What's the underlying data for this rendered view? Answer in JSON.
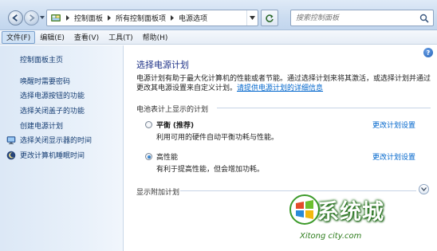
{
  "address_bar": {
    "breadcrumbs": [
      "控制面板",
      "所有控制面板项",
      "电源选项"
    ],
    "search_placeholder": "搜索控制面板"
  },
  "menu": {
    "items": [
      "文件(F)",
      "编辑(E)",
      "查看(V)",
      "工具(T)",
      "帮助(H)"
    ],
    "active_index": 0
  },
  "left_pane": {
    "home_link": "控制面板主页",
    "links": [
      "唤醒时需要密码",
      "选择电源按钮的功能",
      "选择关闭盖子的功能",
      "创建电源计划",
      "选择关闭显示器的时间",
      "更改计算机睡眠时间"
    ]
  },
  "main": {
    "help_glyph": "?",
    "title": "选择电源计划",
    "description": "电源计划有助于最大化计算机的性能或者节能。通过选择计划来将其激活，或选择计划并通过更改其电源设置来自定义计划。",
    "description_link": "请提供电源计划的详细信息",
    "section_label": "电池表计上显示的计划",
    "plans": [
      {
        "name": "平衡",
        "tag": "(推荐)",
        "description": "利用可用的硬件自动平衡功耗与性能。",
        "link": "更改计划设置",
        "selected": false
      },
      {
        "name": "高性能",
        "tag": "",
        "description": "有利于提高性能，但会增加功耗。",
        "link": "更改计划设置",
        "selected": true
      }
    ],
    "additional_plans_label": "显示附加计划"
  },
  "watermark": {
    "brand": "系统城",
    "url": "Xitong city.com"
  },
  "colors": {
    "link": "#0066cc",
    "title": "#1e3287",
    "nav_text": "#143c72",
    "watermark_green": "#2e7d1d"
  }
}
